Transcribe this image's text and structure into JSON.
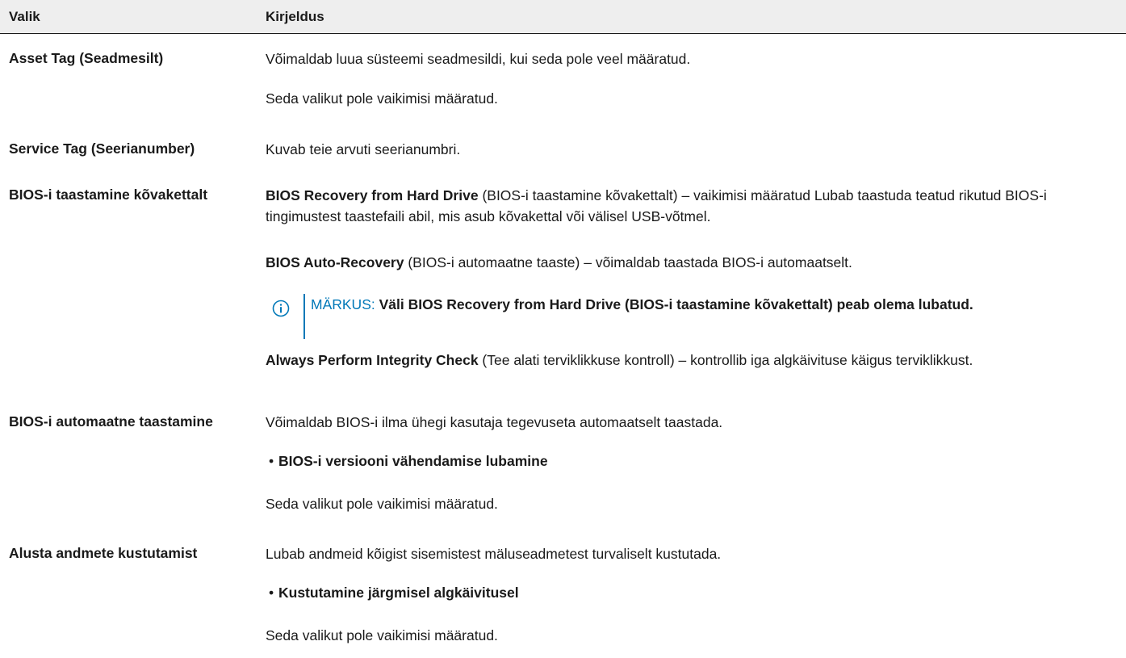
{
  "header": {
    "col1": "Valik",
    "col2": "Kirjeldus"
  },
  "rows": [
    {
      "option": "Asset Tag (Seadmesilt)",
      "desc": "Võimaldab luua süsteemi seadmesildi, kui seda pole veel määratud.",
      "default": "Seda valikut pole vaikimisi määratud."
    },
    {
      "option": "Service Tag (Seerianumber)",
      "desc": "Kuvab teie arvuti seerianumbri."
    },
    {
      "option": "BIOS-i taastamine kõvakettalt",
      "item1_bold": "BIOS Recovery from Hard Drive",
      "item1_text": " (BIOS-i taastamine kõvakettalt) – vaikimisi määratud Lubab taastuda teatud rikutud BIOS-i tingimustest taastefaili abil, mis asub kõvakettal või välisel USB-võtmel.",
      "item2_bold": "BIOS Auto-Recovery",
      "item2_text": " (BIOS-i automaatne taaste) – võimaldab taastada BIOS-i automaatselt.",
      "note_label": "MÄRKUS:",
      "note_text": " Väli BIOS Recovery from Hard Drive (BIOS-i taastamine kõvakettalt) peab olema lubatud.",
      "item3_bold": "Always Perform Integrity Check",
      "item3_text": " (Tee alati terviklikkuse kontroll) – kontrollib iga algkäivituse käigus terviklikkust."
    },
    {
      "option": "BIOS-i automaatne taastamine",
      "desc": "Võimaldab BIOS-i ilma ühegi kasutaja tegevuseta automaatselt taastada.",
      "bullet": "BIOS-i versiooni vähendamise lubamine",
      "default": "Seda valikut pole vaikimisi määratud."
    },
    {
      "option": "Alusta andmete kustutamist",
      "desc": "Lubab andmeid kõigist sisemistest mäluseadmetest turvaliselt kustutada.",
      "bullet": "Kustutamine järgmisel algkäivitusel",
      "default": "Seda valikut pole vaikimisi määratud."
    }
  ],
  "bullet_char": "•",
  "colors": {
    "note_accent": "#0078b8",
    "header_bg": "#eeeeee"
  },
  "icons": {
    "note": "info-circle-icon"
  }
}
